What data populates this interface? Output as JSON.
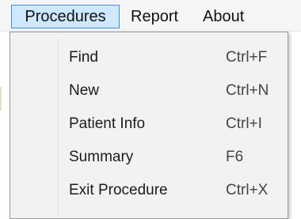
{
  "menubar": {
    "items": [
      {
        "label": "Procedures",
        "active": true
      },
      {
        "label": "Report",
        "active": false
      },
      {
        "label": "About",
        "active": false
      }
    ]
  },
  "dropdown": {
    "items": [
      {
        "label": "Find",
        "shortcut": "Ctrl+F"
      },
      {
        "label": "New",
        "shortcut": "Ctrl+N"
      },
      {
        "label": "Patient Info",
        "shortcut": "Ctrl+I"
      },
      {
        "label": "Summary",
        "shortcut": "F6"
      },
      {
        "label": "Exit Procedure",
        "shortcut": "Ctrl+X"
      }
    ]
  },
  "colors": {
    "menubar_bg": "#f5f5f5",
    "active_highlight": "#cde8ff",
    "active_border": "#3c8fde",
    "dropdown_bg": "#f2f2f2",
    "dropdown_border": "#9b9b9b"
  }
}
